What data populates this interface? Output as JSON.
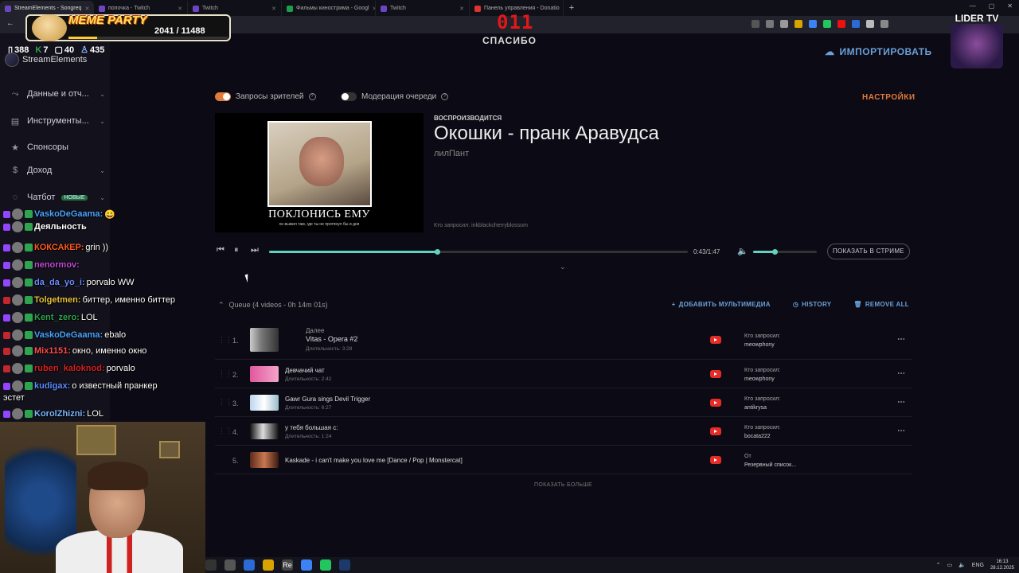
{
  "browser": {
    "tabs": [
      {
        "label": "StreamElements - Songreq",
        "active": true
      },
      {
        "label": "попочка - Twitch"
      },
      {
        "label": "Twitch"
      },
      {
        "label": "Фильмы кинострима - Googl"
      },
      {
        "label": "Twitch"
      },
      {
        "label": "Панель управления - Donatio"
      }
    ],
    "new_tab": "+",
    "close": "✕",
    "window_controls": [
      "—",
      "▢",
      "✕"
    ]
  },
  "overlay": {
    "meme_title": "MEME PARTY",
    "meme_count": "2041 / 11488",
    "meme_progress": 0.18,
    "timer": "011",
    "lider_label": "LIDER TV"
  },
  "stats": {
    "viewers": "388",
    "k": "7",
    "messages": "40",
    "followers": "435"
  },
  "sidebar": {
    "brand": "StreamElements",
    "items": [
      {
        "label": "Данные и отч...",
        "icon": "chart-icon"
      },
      {
        "label": "Инструменты...",
        "icon": "tools-icon"
      },
      {
        "label": "Спонсоры",
        "icon": "star-icon"
      },
      {
        "label": "Доход",
        "icon": "dollar-icon"
      },
      {
        "label": "Чатбот",
        "icon": "chat-icon",
        "badge": "НОВЫЕ"
      }
    ]
  },
  "header": {
    "title": "СПАСИБО",
    "import": "ИМПОРТИРОВАТЬ"
  },
  "controls": {
    "viewer_requests": "Запросы зрителей",
    "queue_moderation": "Модерация очереди",
    "settings": "НАСТРОЙКИ"
  },
  "now_playing": {
    "label": "ВОСПРОИЗВОДИТСЯ",
    "title": "Окошки - пранк Аравудса",
    "artist": "лилПант",
    "requested_by": "Кто запросил: inkblackcherryblossom",
    "video_caption": "ПОКЛОНИСЬ ЕМУ",
    "video_subcaption": "он выжил там, где ты не протянул бы и дня",
    "time": "0:43/1:47",
    "progress": 0.403,
    "volume": 0.35,
    "show_button": "ПОКАЗАТЬ В СТРИМЕ"
  },
  "queue": {
    "header": "Queue (4 videos - 0h 14m 01s)",
    "add_media": "ДОБАВИТЬ МУЛЬТИМЕДИА",
    "history": "HISTORY",
    "remove_all": "REMOVE ALL",
    "show_more": "ПОКАЗАТЬ БОЛЬШЕ",
    "items": [
      {
        "num": "1.",
        "next": "Далее",
        "title": "Vitas - Opera #2",
        "duration": "Длительность: 3:28",
        "req_label": "Кто запросил:",
        "req_user": "meowphony"
      },
      {
        "num": "2.",
        "title": "Девчачий чат",
        "duration": "Длительность: 2:42",
        "req_label": "Кто запросил:",
        "req_user": "meowphony"
      },
      {
        "num": "3.",
        "title": "Gawr Gura sings Devil Trigger",
        "duration": "Длительность: 6:27",
        "req_label": "Кто запросил:",
        "req_user": "antikrysa"
      },
      {
        "num": "4.",
        "title": "у тебя большая с:",
        "duration": "Длительность: 1:24",
        "req_label": "Кто запросил:",
        "req_user": "bocata222"
      },
      {
        "num": "5.",
        "title": "Kaskade - i can't make you love me [Dance / Pop | Monstercat]",
        "duration": "",
        "req_label": "От",
        "req_user": "Резервный список..."
      }
    ]
  },
  "chat": [
    {
      "nick": "VaskoDeGaama:",
      "text": "😀",
      "color": "#4aa3ff"
    },
    {
      "nick": "Деяльность",
      "text": "",
      "color": "#ffffff"
    },
    {
      "nick": "КОКСАКЕР:",
      "text": "grin ))",
      "color": "#ff5a1f"
    },
    {
      "nick": "nenormov:",
      "text": "",
      "color": "#c04bd8"
    },
    {
      "nick": "da_da_yo_i:",
      "text": "porvalo WW",
      "color": "#6a8cff"
    },
    {
      "nick": "Tolgetmen:",
      "text": "биттер, именно биттер",
      "color": "#e8c13a"
    },
    {
      "nick": "Kent_zero:",
      "text": "LOL",
      "color": "#2ea44f"
    },
    {
      "nick": "VaskoDeGaama:",
      "text": "ebalo",
      "color": "#4aa3ff"
    },
    {
      "nick": "Mix1151:",
      "text": "окно, именно окно",
      "color": "#ff4d4d"
    },
    {
      "nick": "ruben_kaloknod:",
      "text": "porvalo",
      "color": "#d62222"
    },
    {
      "nick": "kudigax:",
      "text": "о известный пранкер",
      "color": "#5a8cff"
    },
    {
      "nick": "",
      "text": "эстет",
      "color": "#ffffff"
    },
    {
      "nick": "KorolZhizni:",
      "text": "LOL",
      "color": "#7ab8ff"
    }
  ],
  "taskbar": {
    "lang": "ENG",
    "time": "16:13",
    "date": "28.12.2025"
  }
}
